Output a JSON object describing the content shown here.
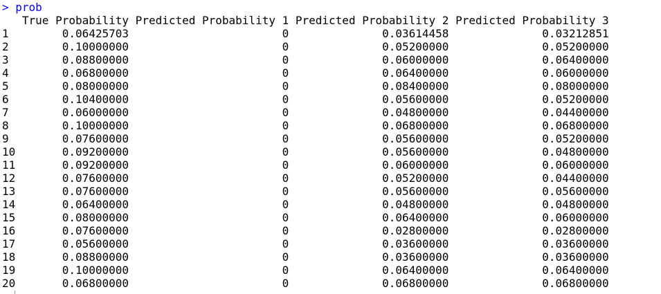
{
  "console": {
    "prompt": ">",
    "command": "prob",
    "headers": [
      "True Probability",
      "Predicted Probability 1",
      "Predicted Probability 2",
      "Predicted Probability 3"
    ],
    "rows": [
      [
        "1",
        "0.06425703",
        "0",
        "0.03614458",
        "0.03212851"
      ],
      [
        "2",
        "0.10000000",
        "0",
        "0.05200000",
        "0.05200000"
      ],
      [
        "3",
        "0.08800000",
        "0",
        "0.06000000",
        "0.06400000"
      ],
      [
        "4",
        "0.06800000",
        "0",
        "0.06400000",
        "0.06000000"
      ],
      [
        "5",
        "0.08000000",
        "0",
        "0.08400000",
        "0.08000000"
      ],
      [
        "6",
        "0.10400000",
        "0",
        "0.05600000",
        "0.05200000"
      ],
      [
        "7",
        "0.06000000",
        "0",
        "0.04800000",
        "0.04400000"
      ],
      [
        "8",
        "0.10000000",
        "0",
        "0.06800000",
        "0.06800000"
      ],
      [
        "9",
        "0.07600000",
        "0",
        "0.05600000",
        "0.05200000"
      ],
      [
        "10",
        "0.09200000",
        "0",
        "0.05600000",
        "0.04800000"
      ],
      [
        "11",
        "0.09200000",
        "0",
        "0.06000000",
        "0.06000000"
      ],
      [
        "12",
        "0.07600000",
        "0",
        "0.05200000",
        "0.04400000"
      ],
      [
        "13",
        "0.07600000",
        "0",
        "0.05600000",
        "0.05600000"
      ],
      [
        "14",
        "0.06400000",
        "0",
        "0.04800000",
        "0.04800000"
      ],
      [
        "15",
        "0.08000000",
        "0",
        "0.06400000",
        "0.06000000"
      ],
      [
        "16",
        "0.07600000",
        "0",
        "0.02800000",
        "0.02800000"
      ],
      [
        "17",
        "0.05600000",
        "0",
        "0.03600000",
        "0.03600000"
      ],
      [
        "18",
        "0.08800000",
        "0",
        "0.03600000",
        "0.03600000"
      ],
      [
        "19",
        "0.10000000",
        "0",
        "0.06400000",
        "0.06400000"
      ],
      [
        "20",
        "0.06800000",
        "0",
        "0.06800000",
        "0.06800000"
      ]
    ]
  },
  "colors": {
    "command": "#0000ff",
    "output": "#000000",
    "background": "#ffffff"
  }
}
